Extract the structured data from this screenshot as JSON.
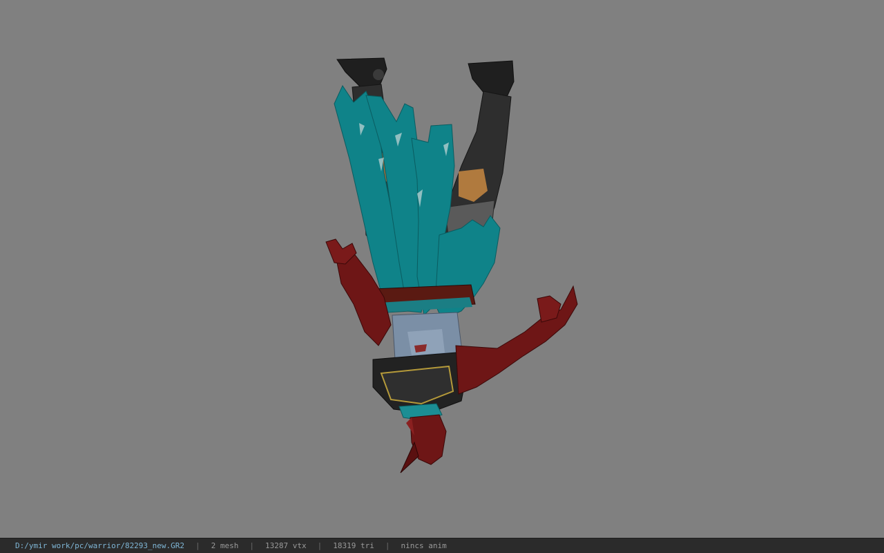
{
  "status": {
    "file_path": "D:/ymir work/pc/warrior/82293_new.GR2",
    "separator": "|",
    "mesh": "2 mesh",
    "vertices": "13287 vtx",
    "triangles": "18319 tri",
    "animation": "nincs anim"
  },
  "colors": {
    "background": "#808080",
    "statusbar": "#2b2b2b",
    "armor_red": "#7a1a1a",
    "cloth_teal": "#138a8f",
    "boots_dark": "#2a2a2a"
  }
}
